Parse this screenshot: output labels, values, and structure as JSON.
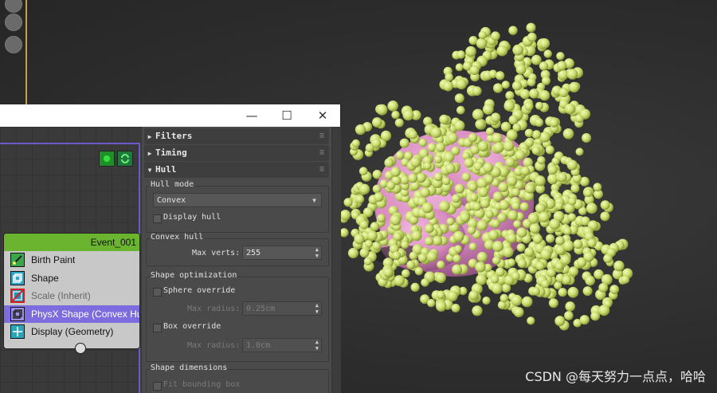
{
  "window": {
    "minimize_glyph": "—",
    "maximize_glyph": "☐",
    "close_glyph": "✕"
  },
  "event": {
    "name": "Event_001",
    "operators": [
      {
        "label": "Birth Paint",
        "icon": "birth-paint-icon",
        "state": "normal"
      },
      {
        "label": "Shape",
        "icon": "shape-icon",
        "state": "normal"
      },
      {
        "label": "Scale (Inherit)",
        "icon": "scale-disabled-icon",
        "state": "disabled"
      },
      {
        "label": "PhysX Shape (Convex Hull",
        "icon": "physx-shape-icon",
        "state": "selected"
      },
      {
        "label": "Display (Geometry)",
        "icon": "display-geometry-icon",
        "state": "normal"
      }
    ]
  },
  "rollouts": {
    "filters": "Filters",
    "timing": "Timing",
    "hull": "Hull"
  },
  "hull_mode": {
    "label": "Hull mode",
    "selected": "Convex",
    "display_hull": "Display hull"
  },
  "convex_hull": {
    "label": "Convex hull",
    "max_verts_label": "Max verts:",
    "max_verts_value": "255"
  },
  "shape_optimization": {
    "label": "Shape optimization",
    "sphere_override": "Sphere override",
    "max_radius_label": "Max radius:",
    "sphere_max_radius": "0.25cm",
    "box_override": "Box override",
    "box_max_radius": "1.0cm"
  },
  "shape_dimensions": {
    "label": "Shape dimensions",
    "fit_bounding_box": "Fit bounding box"
  },
  "watermark": "CSDN @每天努力一点点，哈哈",
  "colors": {
    "particle": "#c9dc6e",
    "blob": "#d98cc0",
    "event_header": "#6ab42f",
    "selected_row": "#7d6be0"
  }
}
